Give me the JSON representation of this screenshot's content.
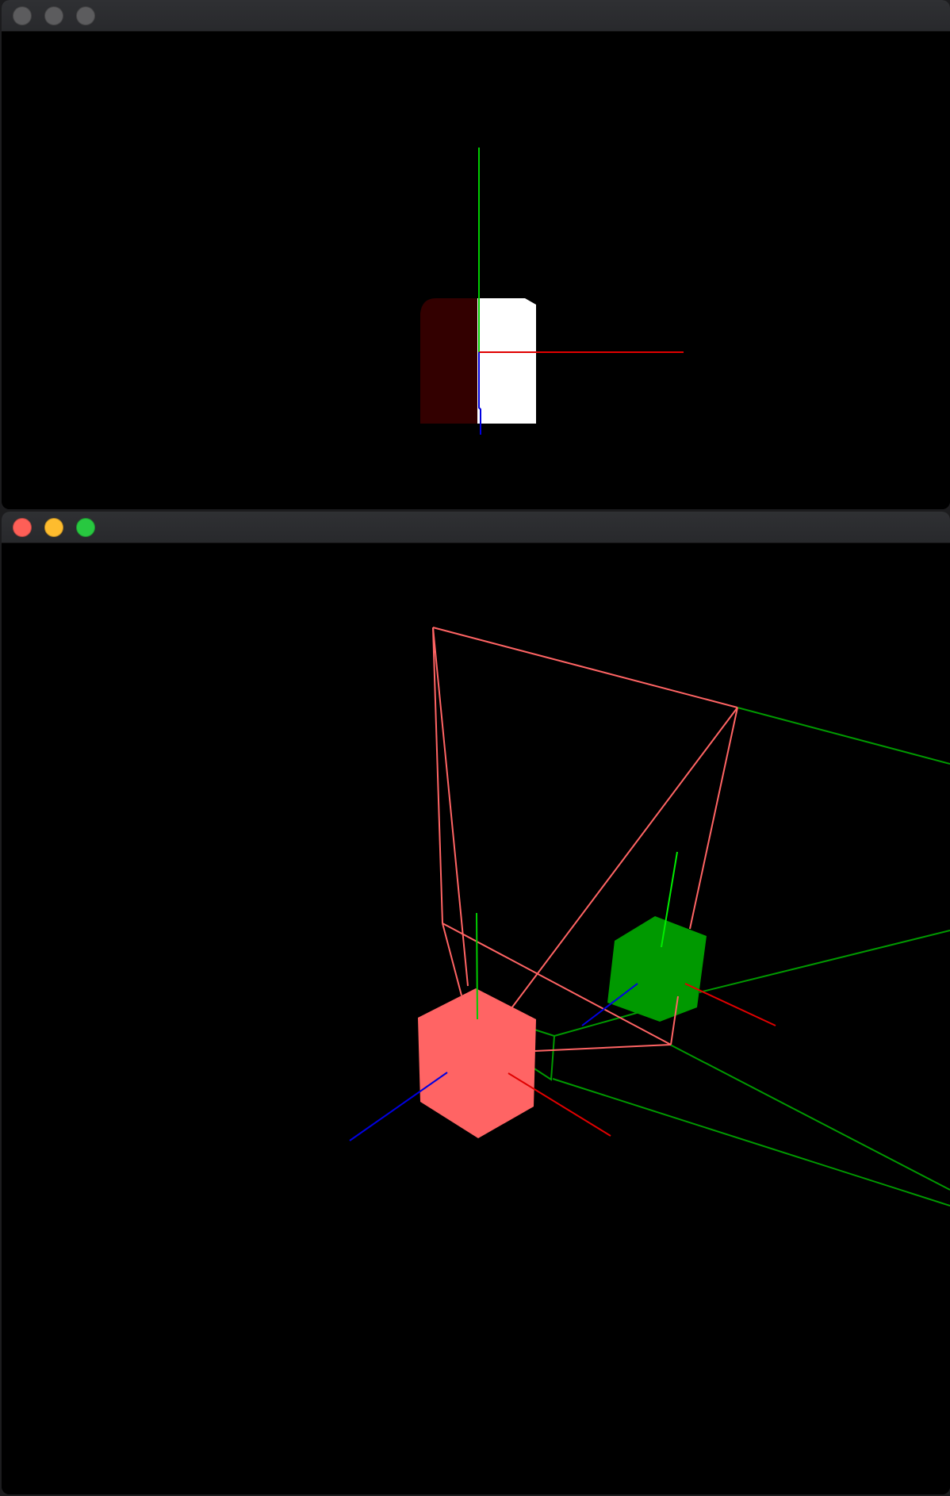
{
  "windows": [
    {
      "id": "top",
      "title": "",
      "active": false,
      "buttons": [
        "close",
        "minimize",
        "zoom"
      ]
    },
    {
      "id": "bottom",
      "title": "",
      "active": true,
      "buttons": [
        "close",
        "minimize",
        "zoom"
      ]
    }
  ],
  "colors": {
    "close": "#fe5f57",
    "minimize": "#febc2e",
    "zoom": "#28c840",
    "axis_x": "#e00000",
    "axis_y": "#00cc00",
    "axis_z": "#0000e0",
    "cube_camera": "#ff6464",
    "cube_target": "#009900",
    "frustum_camera": "#ff6464",
    "frustum_target": "#009900",
    "top_cube_shadow": "#330000",
    "top_cube_face": "#ffffff"
  }
}
